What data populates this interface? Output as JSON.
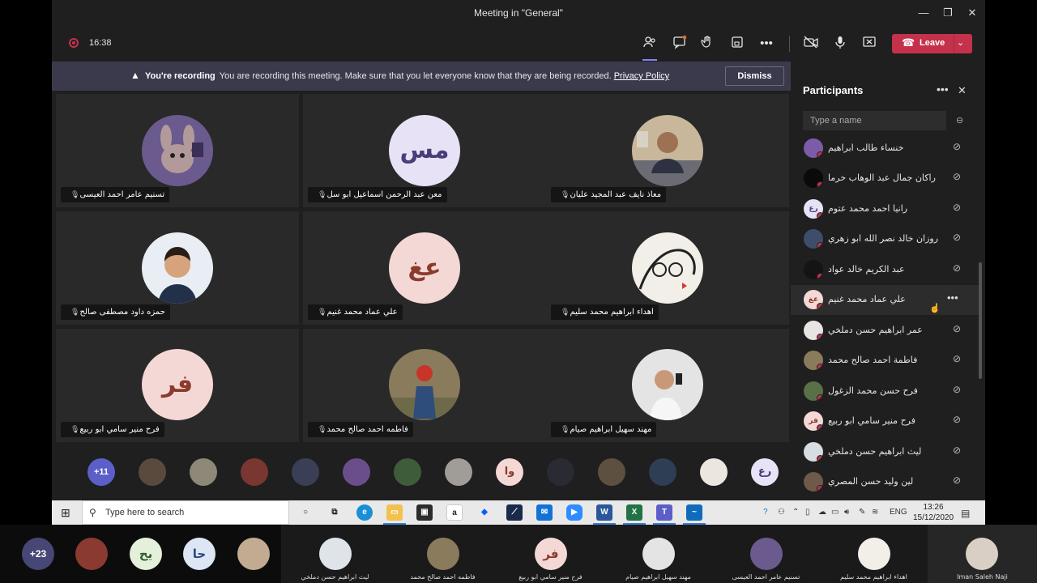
{
  "window": {
    "title": "Meeting in \"General\"",
    "minimize": "—",
    "restore": "❐",
    "close": "✕"
  },
  "meeting": {
    "timer": "16:38",
    "leave_label": "Leave",
    "leave_color": "#c4314b",
    "toolbar_icons": [
      "people-icon",
      "chat-icon",
      "raise-hand-icon",
      "share-tray-icon",
      "more-actions-icon",
      "camera-off-icon",
      "mic-icon",
      "share-screen-icon"
    ]
  },
  "banner": {
    "title": "You're recording",
    "message": "You are recording this meeting. Make sure that you let everyone know that they are being recorded.",
    "link": "Privacy Policy",
    "dismiss": "Dismiss"
  },
  "grid": [
    {
      "name": "تسنيم عامر احمد العيسى",
      "avatar": "photo"
    },
    {
      "name": "معن عبد الرحمن اسماعيل ابو سل",
      "avatar": "initials",
      "initials": "مس"
    },
    {
      "name": "معاذ نايف عبد المجيد عليان",
      "avatar": "photo"
    },
    {
      "name": "حمزه داود مصطفى صالح",
      "avatar": "photo"
    },
    {
      "name": "علي عماد محمد غنيم",
      "avatar": "initials",
      "initials": "عغ"
    },
    {
      "name": "اهداء ابراهيم محمد سليم",
      "avatar": "photo"
    },
    {
      "name": "فرح منير سامي ابو ربيع",
      "avatar": "initials",
      "initials": "فر"
    },
    {
      "name": "فاطمه احمد صالح محمد",
      "avatar": "photo"
    },
    {
      "name": "مهند سهيل ابراهيم صيام",
      "avatar": "photo"
    }
  ],
  "strip": {
    "more": "+11",
    "initials": [
      "وا",
      "رع"
    ]
  },
  "participants": {
    "title": "Participants",
    "search_placeholder": "Type a name",
    "hovered_index": 5,
    "rows": [
      {
        "name": "خنساء طالب ابراهيم",
        "initials": ""
      },
      {
        "name": "راكان جمال عبد الوهاب خرما",
        "initials": ""
      },
      {
        "name": "رانيا احمد محمد عتوم",
        "initials": "رع"
      },
      {
        "name": "روزان خالد نصر الله ابو زهري",
        "initials": ""
      },
      {
        "name": "عبد الكريم خالد عواد",
        "initials": ""
      },
      {
        "name": "علي عماد محمد غنيم",
        "initials": "عغ"
      },
      {
        "name": "عمر ابراهيم حسن دملخي",
        "initials": ""
      },
      {
        "name": "فاطمة احمد صالح محمد",
        "initials": ""
      },
      {
        "name": "فرح حسن محمد الزغول",
        "initials": ""
      },
      {
        "name": "فرح منير سامي ابو ربيع",
        "initials": "فر"
      },
      {
        "name": "ليث ابراهيم حسن دملخي",
        "initials": ""
      },
      {
        "name": "لين وليد حسن المصري",
        "initials": ""
      }
    ]
  },
  "taskbar": {
    "search_placeholder": "Type here to search",
    "language": "ENG",
    "time": "13:26",
    "date": "15/12/2020"
  },
  "outer": {
    "more": "+23",
    "circles": [
      "يح",
      "حا"
    ],
    "tiles": [
      {
        "label": "ليث ابراهيم حسن دملخي"
      },
      {
        "label": "فاطمه احمد صالح محمد"
      },
      {
        "label": "فرح منير سامي ابو ربيع",
        "initials": "فر"
      },
      {
        "label": "مهند سهيل ابراهيم صيام"
      },
      {
        "label": "تسنيم عامر احمد العيسى"
      },
      {
        "label": "اهداء ابراهيم محمد سليم"
      },
      {
        "label": "Iman Saleh Naji"
      }
    ]
  }
}
